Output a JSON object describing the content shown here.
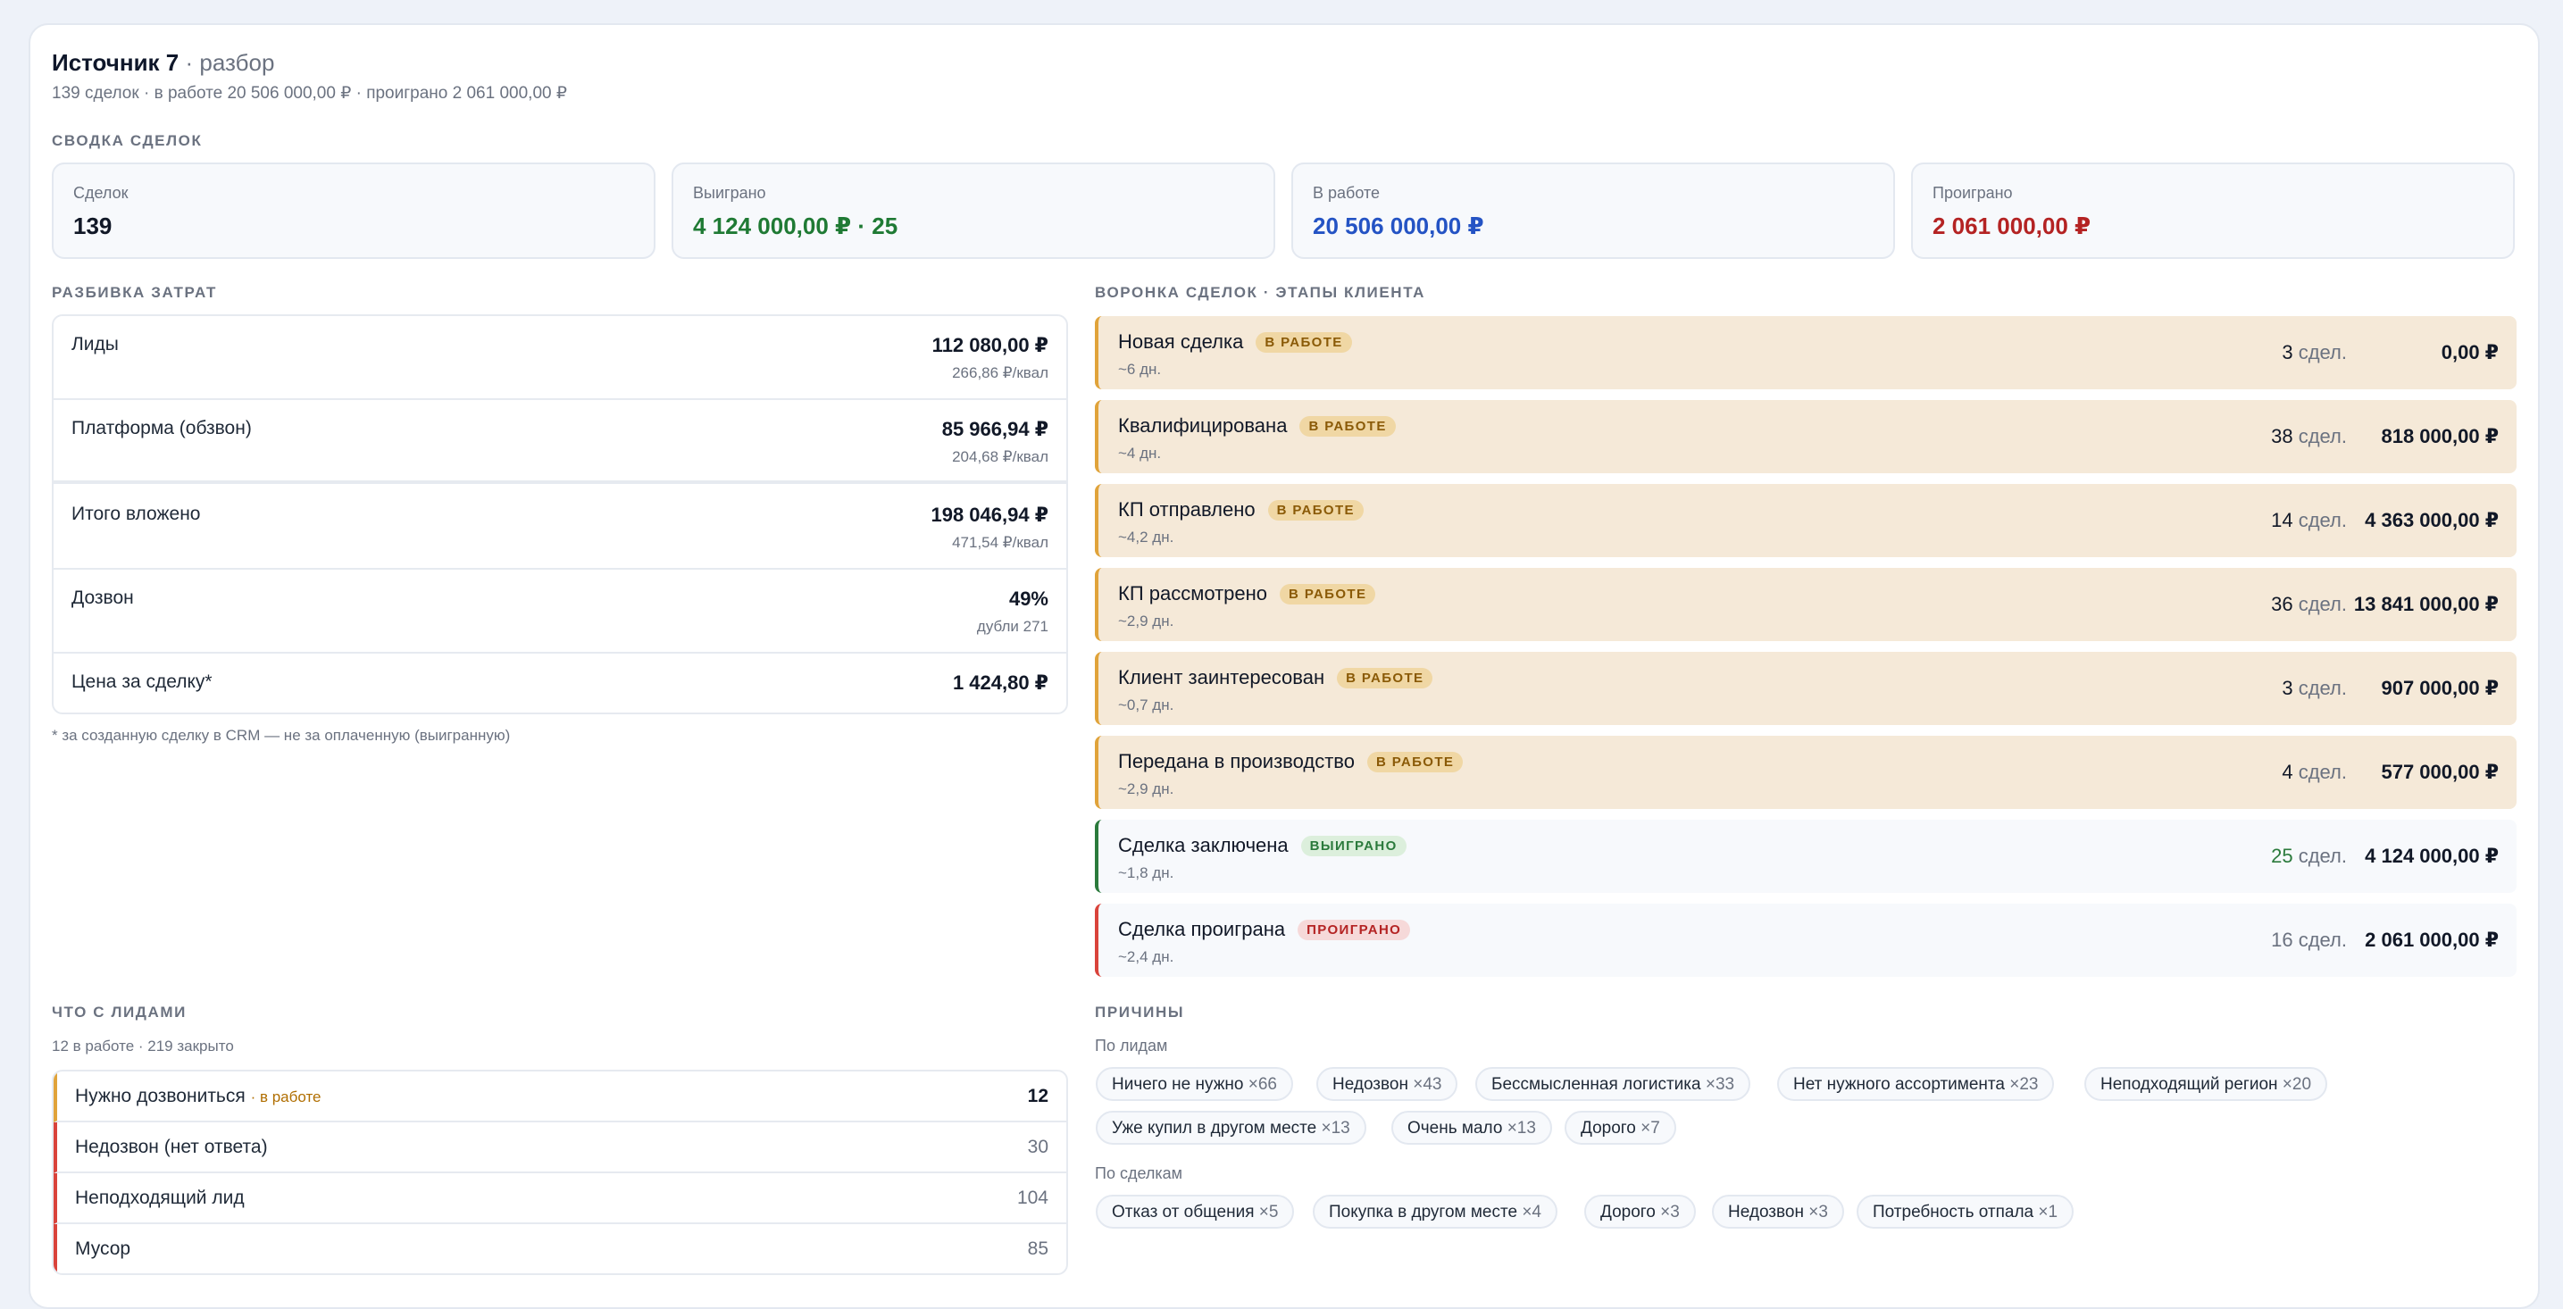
{
  "header": {
    "title": "Источник 7",
    "subtitle": "· разбор",
    "meta": "139 сделок · в работе 20 506 000,00 ₽ · проиграно 2 061 000,00 ₽"
  },
  "summary": {
    "title": "СВОДКА СДЕЛОК",
    "cards": [
      {
        "label": "Сделок",
        "value": "139",
        "color": "#111827"
      },
      {
        "label": "Выиграно",
        "value": "4 124 000,00 ₽ · 25",
        "color": "#1f7a34"
      },
      {
        "label": "В работе",
        "value": "20 506 000,00 ₽",
        "color": "#2453c4"
      },
      {
        "label": "Проиграно",
        "value": "2 061 000,00 ₽",
        "color": "#b42323"
      }
    ]
  },
  "costs": {
    "title": "РАЗБИВКА ЗАТРАТ",
    "rows": [
      {
        "label": "Лиды",
        "value": "112 080,00 ₽",
        "note": "266,86 ₽/квал"
      },
      {
        "label": "Платформа (обзвон)",
        "value": "85 966,94 ₽",
        "note": "204,68 ₽/квал"
      },
      {
        "label": "Итого вложено",
        "value": "198 046,94 ₽",
        "note": "471,54 ₽/квал"
      },
      {
        "label": "Дозвон",
        "value": "49%",
        "note": "дубли 271"
      },
      {
        "label": "Цена за сделку*",
        "value": "1 424,80 ₽",
        "note": ""
      }
    ],
    "footnote": "* за созданную сделку в CRM — не за оплаченную (выигранную)"
  },
  "funnel": {
    "title": "ВОРОНКА СДЕЛОК · ЭТАПЫ КЛИЕНТА",
    "unit": "сдел.",
    "stages": [
      {
        "name": "Новая сделка",
        "badge": "В РАБОТЕ",
        "duration": "~6 дн.",
        "count": "3",
        "amount": "0,00 ₽",
        "status": "work"
      },
      {
        "name": "Квалифицирована",
        "badge": "В РАБОТЕ",
        "duration": "~4 дн.",
        "count": "38",
        "amount": "818 000,00 ₽",
        "status": "work"
      },
      {
        "name": "КП отправлено",
        "badge": "В РАБОТЕ",
        "duration": "~4,2 дн.",
        "count": "14",
        "amount": "4 363 000,00 ₽",
        "status": "work"
      },
      {
        "name": "КП рассмотрено",
        "badge": "В РАБОТЕ",
        "duration": "~2,9 дн.",
        "count": "36",
        "amount": "13 841 000,00 ₽",
        "status": "work"
      },
      {
        "name": "Клиент заинтересован",
        "badge": "В РАБОТЕ",
        "duration": "~0,7 дн.",
        "count": "3",
        "amount": "907 000,00 ₽",
        "status": "work"
      },
      {
        "name": "Передана в производство",
        "badge": "В РАБОТЕ",
        "duration": "~2,9 дн.",
        "count": "4",
        "amount": "577 000,00 ₽",
        "status": "work"
      },
      {
        "name": "Сделка заключена",
        "badge": "ВЫИГРАНО",
        "duration": "~1,8 дн.",
        "count": "25",
        "amount": "4 124 000,00 ₽",
        "status": "won"
      },
      {
        "name": "Сделка проиграна",
        "badge": "ПРОИГРАНО",
        "duration": "~2,4 дн.",
        "count": "16",
        "amount": "2 061 000,00 ₽",
        "status": "lost"
      }
    ]
  },
  "leads": {
    "title": "ЧТО С ЛИДАМИ",
    "summary": "12 в работе · 219 закрыто",
    "rows": [
      {
        "label": "Нужно дозвониться",
        "tag": "· в работе",
        "count": "12"
      },
      {
        "label": "Недозвон (нет ответа)",
        "tag": "",
        "count": "30"
      },
      {
        "label": "Неподходящий лид",
        "tag": "",
        "count": "104"
      },
      {
        "label": "Мусор",
        "tag": "",
        "count": "85"
      }
    ]
  },
  "reasons": {
    "title": "ПРИЧИНЫ",
    "by_leads_label": "По лидам",
    "by_leads": [
      {
        "label": "Ничего не нужно",
        "count": "×66"
      },
      {
        "label": "Недозвон",
        "count": "×43"
      },
      {
        "label": "Бессмысленная логистика",
        "count": "×33"
      },
      {
        "label": "Нет нужного ассортимента",
        "count": "×23"
      },
      {
        "label": "Неподходящий регион",
        "count": "×20"
      },
      {
        "label": "Уже купил в другом месте",
        "count": "×13"
      },
      {
        "label": "Очень мало",
        "count": "×13"
      },
      {
        "label": "Дорого",
        "count": "×7"
      }
    ],
    "by_deals_label": "По сделкам",
    "by_deals": [
      {
        "label": "Отказ от общения",
        "count": "×5"
      },
      {
        "label": "Покупка в другом месте",
        "count": "×4"
      },
      {
        "label": "Дорого",
        "count": "×3"
      },
      {
        "label": "Недозвон",
        "count": "×3"
      },
      {
        "label": "Потребность отпала",
        "count": "×1"
      }
    ]
  }
}
